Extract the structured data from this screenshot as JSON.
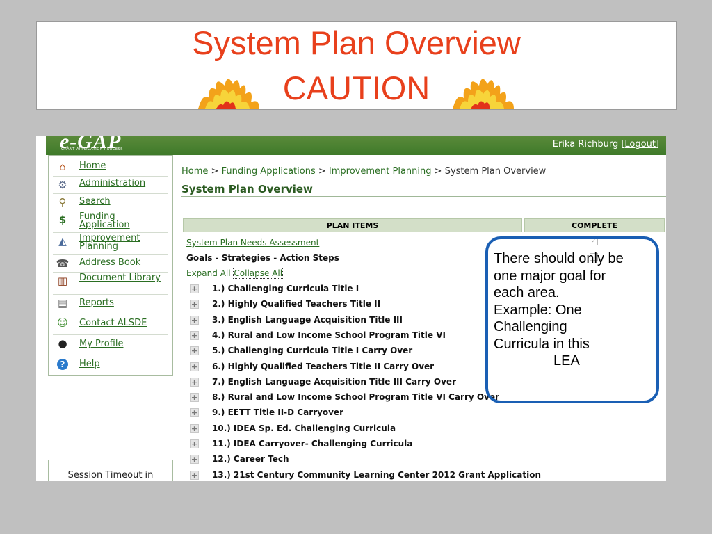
{
  "slide": {
    "title_line1": "System Plan Overview",
    "title_line2": "CAUTION"
  },
  "app": {
    "logo": "e-GAP",
    "logo_subtitle": "GRANT APPLICATION PROCESS",
    "user_name": "Erika Richburg",
    "logout_label": "[Logout]"
  },
  "sidebar": {
    "items": [
      {
        "label": "Home",
        "icon": "home-icon"
      },
      {
        "label": "Administration",
        "icon": "admin-icon"
      },
      {
        "label": "Search",
        "icon": "search-icon"
      },
      {
        "label": "Funding Application",
        "icon": "dollar-icon"
      },
      {
        "label": "Improvement Planning",
        "icon": "chart-icon"
      },
      {
        "label": "Address Book",
        "icon": "address-book-icon"
      },
      {
        "label": "Document Library",
        "icon": "books-icon"
      },
      {
        "label": "Reports",
        "icon": "reports-icon"
      },
      {
        "label": "Contact ALSDE",
        "icon": "contact-icon"
      },
      {
        "label": "My Profile",
        "icon": "profile-icon"
      },
      {
        "label": "Help",
        "icon": "help-icon"
      }
    ],
    "session_timeout": "Session Timeout in"
  },
  "breadcrumb": {
    "home": "Home",
    "funding": "Funding Applications",
    "improvement": "Improvement Planning",
    "current": "System Plan Overview",
    "sep": ">"
  },
  "page": {
    "title": "System Plan Overview",
    "col_plan_items": "PLAN ITEMS",
    "col_complete": "COMPLETE",
    "needs_assessment": "System Plan Needs Assessment",
    "goals": "Goals - Strategies - Action Steps",
    "expand_all": "Expand All",
    "collapse_all": "Collapse All",
    "plan_items": [
      "1.) Challenging Curricula Title I",
      "2.) Highly Qualified Teachers Title II",
      "3.) English Language Acquisition Title III",
      "4.) Rural and Low Income School Program Title VI",
      "5.) Challenging Curricula Title I Carry Over",
      "6.) Highly Qualified Teachers Title II Carry Over",
      "7.) English Language Acquisition Title III Carry Over",
      "8.) Rural and Low Income School Program Title VI Carry Over",
      "9.) EETT Title II-D Carryover",
      "10.) IDEA Sp. Ed. Challenging Curricula",
      "11.) IDEA Carryover- Challenging Curricula",
      "12.) Career Tech",
      "13.) 21st Century Community Learning Center 2012 Grant Application"
    ]
  },
  "callout": {
    "text_lines": [
      "There should only be",
      "one major goal for",
      "each area.",
      "Example:  One",
      "Challenging",
      "Curricula  in this",
      "LEA"
    ],
    "border_color": "#1a5fb4"
  },
  "colors": {
    "title_red": "#e8401c",
    "banner_green": "#3f7a2a",
    "link_green": "#2a6e22"
  }
}
